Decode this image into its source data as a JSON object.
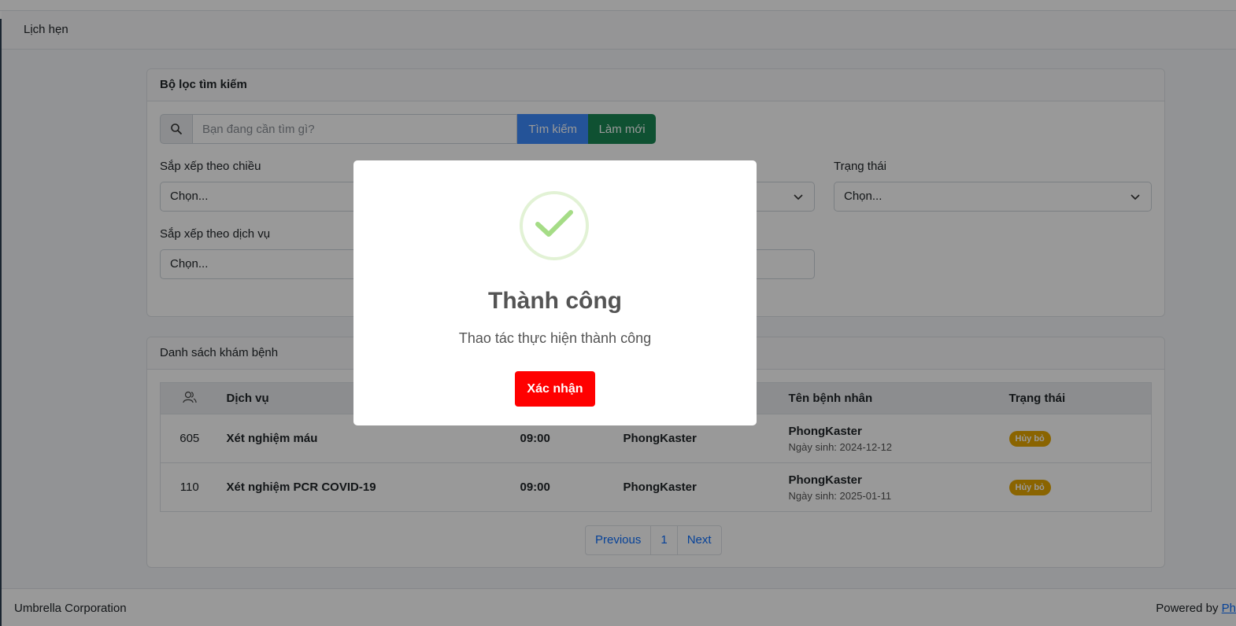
{
  "subheader": {
    "title": "Lịch hẹn"
  },
  "filter": {
    "header": "Bộ lọc tìm kiếm",
    "search_placeholder": "Bạn đang cần tìm gì?",
    "search_button": "Tìm kiếm",
    "reset_button": "Làm mới",
    "sort_direction_label": "Sắp xếp theo chiều",
    "sort_direction_value": "Chọn...",
    "status_label": "Trạng thái",
    "status_value": "Chọn...",
    "sort_service_label": "Sắp xếp theo dịch vụ",
    "sort_service_value": "Chọn..."
  },
  "list": {
    "header": "Danh sách khám bệnh",
    "columns": [
      "Dịch vụ",
      "Tên bệnh nhân",
      "Trạng thái"
    ],
    "rows": [
      {
        "id": "605",
        "service": "Xét nghiệm máu",
        "time": "09:00",
        "doctor": "PhongKaster",
        "patient": "PhongKaster",
        "dob": "Ngày sinh: 2024-12-12",
        "status": "Hủy bỏ"
      },
      {
        "id": "110",
        "service": "Xét nghiệm PCR COVID-19",
        "time": "09:00",
        "doctor": "PhongKaster",
        "patient": "PhongKaster",
        "dob": "Ngày sinh: 2025-01-11",
        "status": "Hủy bỏ"
      }
    ]
  },
  "pagination": {
    "previous": "Previous",
    "page": "1",
    "next": "Next"
  },
  "footer": {
    "left": "Umbrella Corporation",
    "right_prefix": "Powered by ",
    "right_link": "Ph"
  },
  "modal": {
    "title": "Thành công",
    "text": "Thao tác thực hiện thành công",
    "confirm": "Xác nhận"
  },
  "colors": {
    "success_icon": "#a5dc86",
    "confirm_button": "#ff0000",
    "badge": "#e6a700",
    "search_button": "#3d8bfd",
    "reset_button": "#198754"
  }
}
